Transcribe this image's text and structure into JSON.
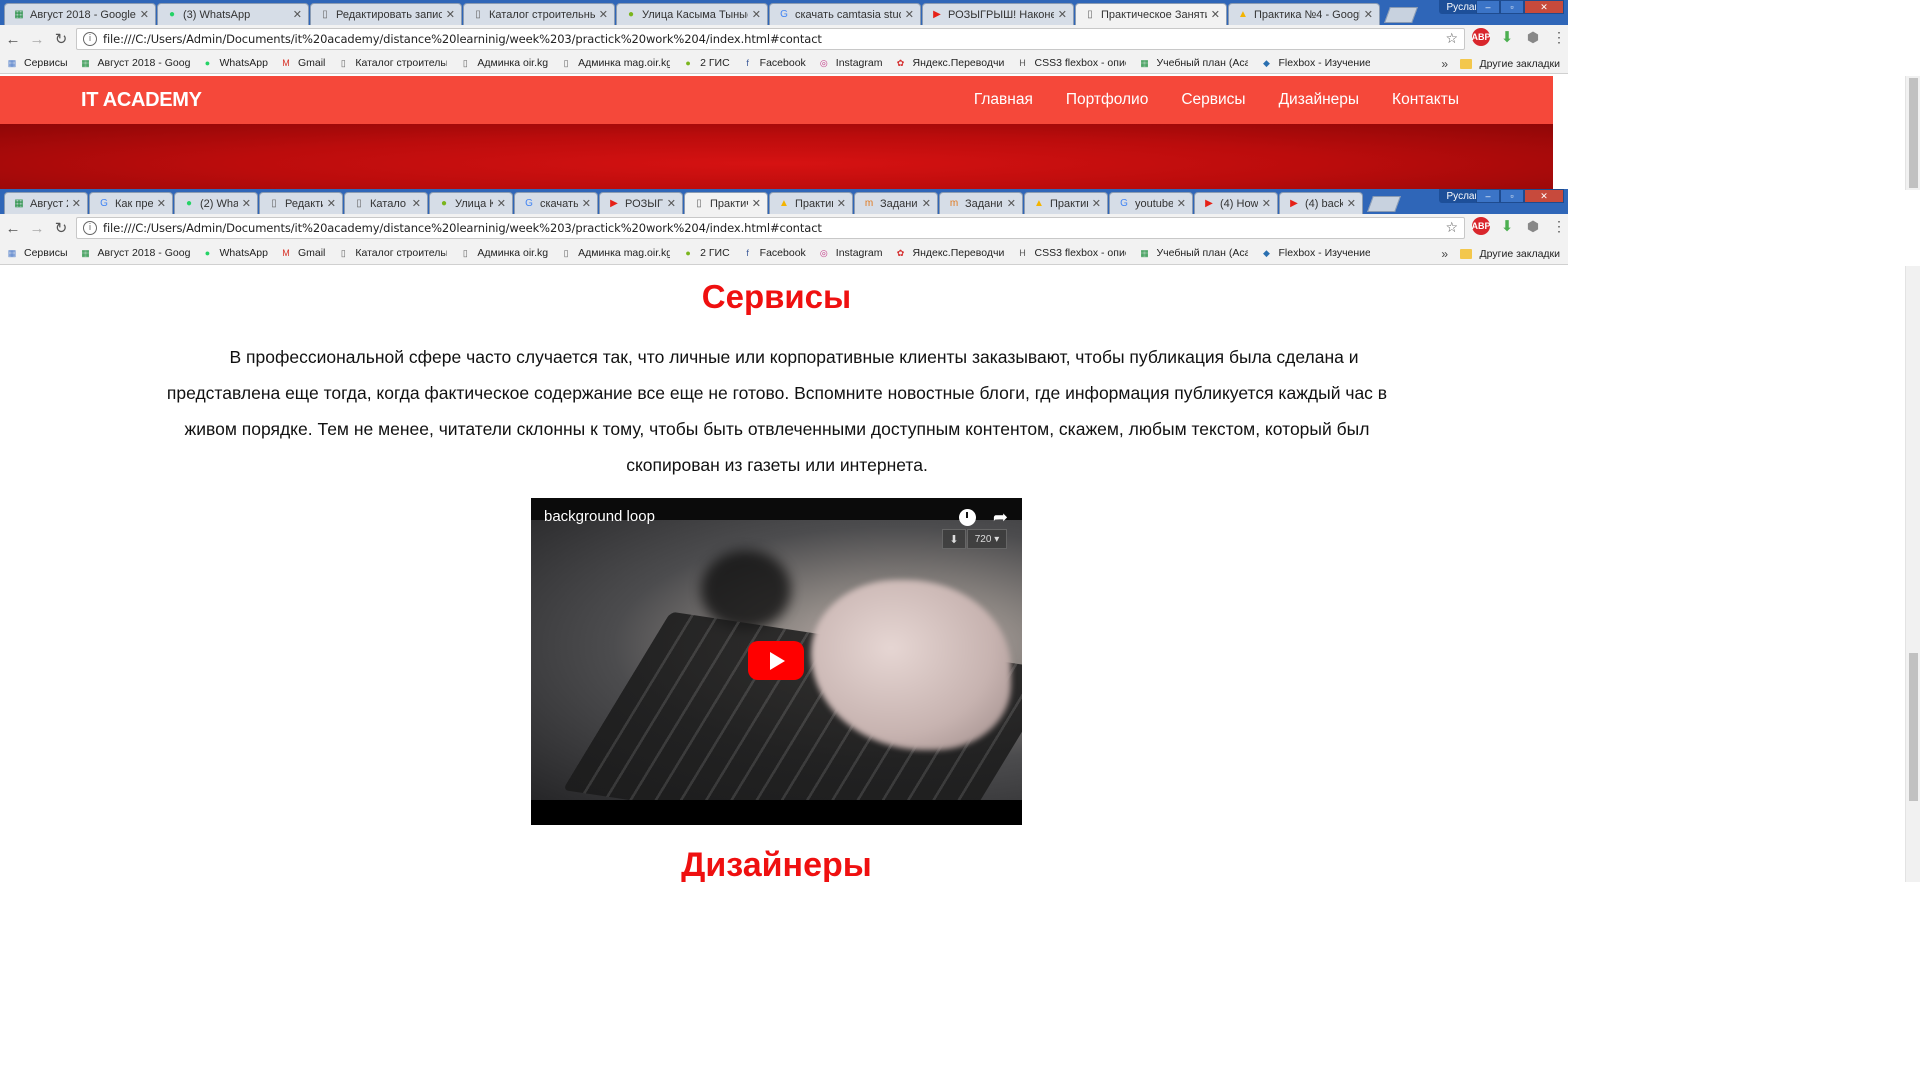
{
  "top_window": {
    "tabs": [
      {
        "title": "Август 2018 - Google Та",
        "icon": "sheets",
        "active": false
      },
      {
        "title": "(3) WhatsApp",
        "icon": "whatsapp",
        "active": false
      },
      {
        "title": "Редактировать запись «",
        "icon": "doc",
        "active": false
      },
      {
        "title": "Каталог строительных м",
        "icon": "doc",
        "active": false
      },
      {
        "title": "Улица Касыма Тыныста",
        "icon": "2gis",
        "active": false
      },
      {
        "title": "скачать camtasia studio",
        "icon": "google",
        "active": false
      },
      {
        "title": "РОЗЫГРЫШ! Наконец-т",
        "icon": "youtube",
        "active": false
      },
      {
        "title": "Практическое Занятие",
        "icon": "doc",
        "active": true
      },
      {
        "title": "Практика №4 - Google",
        "icon": "drive",
        "active": false
      }
    ],
    "profile": "Руслан",
    "url": "file:///C:/Users/Admin/Documents/it%20academy/distance%20learninig/week%203/practick%20work%204/index.html#contact",
    "site": {
      "logo": "IT ACADEMY",
      "menu": [
        "Главная",
        "Портфолио",
        "Сервисы",
        "Дизайнеры",
        "Контакты"
      ]
    }
  },
  "bottom_window": {
    "tabs": [
      {
        "title": "Август 2",
        "icon": "sheets",
        "active": false
      },
      {
        "title": "Как пре",
        "icon": "google",
        "active": false
      },
      {
        "title": "(2) What",
        "icon": "whatsapp",
        "active": false
      },
      {
        "title": "Редакти",
        "icon": "doc",
        "active": false
      },
      {
        "title": "Катало",
        "icon": "doc",
        "active": false
      },
      {
        "title": "Улица К",
        "icon": "2gis",
        "active": false
      },
      {
        "title": "скачать",
        "icon": "google",
        "active": false
      },
      {
        "title": "РОЗЫГР",
        "icon": "youtube",
        "active": false
      },
      {
        "title": "Практич",
        "icon": "doc",
        "active": true
      },
      {
        "title": "Практик",
        "icon": "drive",
        "active": false
      },
      {
        "title": "Задание",
        "icon": "moodle",
        "active": false
      },
      {
        "title": "Задание",
        "icon": "moodle",
        "active": false
      },
      {
        "title": "Практик",
        "icon": "drive",
        "active": false
      },
      {
        "title": "youtube",
        "icon": "google",
        "active": false
      },
      {
        "title": "(4) How",
        "icon": "youtube",
        "active": false
      },
      {
        "title": "(4) back",
        "icon": "youtube",
        "active": false
      }
    ],
    "profile": "Руслан",
    "url": "file:///C:/Users/Admin/Documents/it%20academy/distance%20learninig/week%203/practick%20work%204/index.html#contact"
  },
  "bookmarks": [
    {
      "label": "Сервисы",
      "icon": "apps"
    },
    {
      "label": "Август 2018 - Googl",
      "icon": "sheets"
    },
    {
      "label": "WhatsApp",
      "icon": "whatsapp"
    },
    {
      "label": "Gmail",
      "icon": "gmail"
    },
    {
      "label": "Каталог строительн",
      "icon": "doc"
    },
    {
      "label": "Админка oir.kg",
      "icon": "doc"
    },
    {
      "label": "Админка mag.oir.kg",
      "icon": "doc"
    },
    {
      "label": "2 ГИС",
      "icon": "2gis"
    },
    {
      "label": "Facebook",
      "icon": "facebook"
    },
    {
      "label": "Instagram",
      "icon": "instagram"
    },
    {
      "label": "Яндекс.Переводчик",
      "icon": "yandex"
    },
    {
      "label": "CSS3 flexbox - опис",
      "icon": "css"
    },
    {
      "label": "Учебный план (Acad",
      "icon": "sheets"
    },
    {
      "label": "Flexbox - Изучение",
      "icon": "flexbox"
    }
  ],
  "other_bookmarks": "Другие закладки",
  "content": {
    "services_title": "Сервисы",
    "services_text": "В профессиональной сфере часто случается так, что личные или корпоративные клиенты заказывают, чтобы публикация была сделана и представлена еще тогда, когда фактическое содержание все еще не готово. Вспомните новостные блоги, где информация публикуется каждый час в живом порядке. Тем не менее, читатели склонны к тому, чтобы быть отвлеченными доступным контентом, скажем, любым текстом, который был скопирован из газеты или интернета.",
    "video": {
      "title": "background loop",
      "quality": "720"
    },
    "designers_title": "Дизайнеры"
  },
  "colors": {
    "nav_bg": "#f5483a",
    "hero": "#c20d0d",
    "section_title": "#ef1010",
    "chrome_frame": "#2f66b8"
  }
}
